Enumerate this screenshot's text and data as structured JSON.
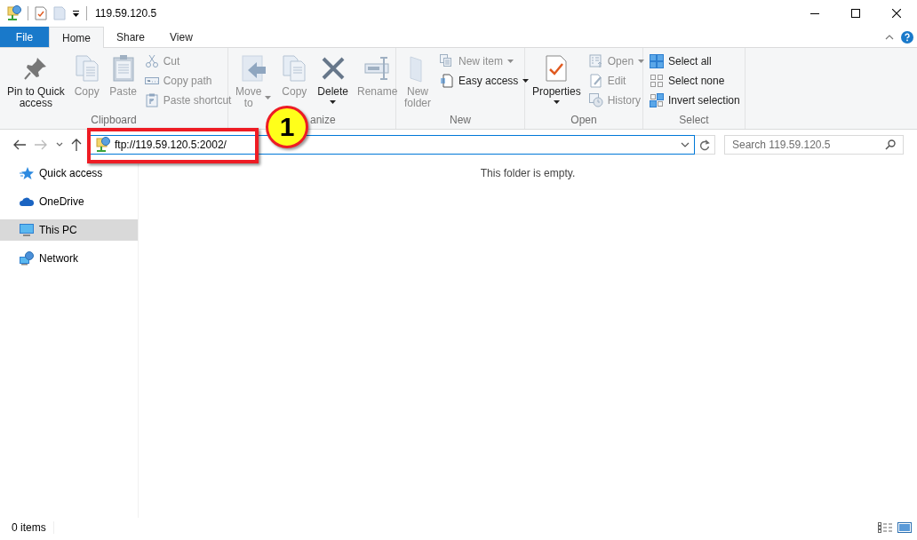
{
  "window": {
    "title": "119.59.120.5"
  },
  "tabs": [
    {
      "label": "File",
      "kind": "file",
      "selected": false
    },
    {
      "label": "Home",
      "kind": "tab",
      "selected": true
    },
    {
      "label": "Share",
      "kind": "tab",
      "selected": false
    },
    {
      "label": "View",
      "kind": "tab",
      "selected": false
    }
  ],
  "ribbon": {
    "groups": [
      {
        "label": "Clipboard",
        "items": [
          {
            "kind": "large",
            "label": "Pin to Quick\naccess",
            "disabled": false,
            "dropdown": false
          },
          {
            "kind": "large",
            "label": "Copy",
            "disabled": true,
            "dropdown": false
          },
          {
            "kind": "large",
            "label": "Paste",
            "disabled": true,
            "dropdown": false
          },
          {
            "kind": "small",
            "label": "Cut",
            "disabled": true,
            "dropdown": false
          },
          {
            "kind": "small",
            "label": "Copy path",
            "disabled": true,
            "dropdown": false
          },
          {
            "kind": "small",
            "label": "Paste shortcut",
            "disabled": true,
            "dropdown": false
          }
        ]
      },
      {
        "label": "anize",
        "items": [
          {
            "kind": "large",
            "label": "Move\nto",
            "disabled": true,
            "dropdown": true
          },
          {
            "kind": "large",
            "label": "Copy",
            "disabled": true,
            "dropdown": false
          },
          {
            "kind": "split",
            "label": "Delete",
            "disabled": false,
            "dropdown": true
          },
          {
            "kind": "large",
            "label": "Rename",
            "disabled": true,
            "dropdown": false
          }
        ]
      },
      {
        "label": "New",
        "items": [
          {
            "kind": "large",
            "label": "New\nfolder",
            "disabled": true,
            "dropdown": false
          },
          {
            "kind": "small",
            "label": "New item",
            "disabled": true,
            "dropdown": true
          },
          {
            "kind": "small",
            "label": "Easy access",
            "disabled": false,
            "dropdown": true
          }
        ]
      },
      {
        "label": "Open",
        "items": [
          {
            "kind": "split",
            "label": "Properties",
            "disabled": false,
            "dropdown": true
          },
          {
            "kind": "small",
            "label": "Open",
            "disabled": true,
            "dropdown": true
          },
          {
            "kind": "small",
            "label": "Edit",
            "disabled": true,
            "dropdown": false
          },
          {
            "kind": "small",
            "label": "History",
            "disabled": true,
            "dropdown": false
          }
        ]
      },
      {
        "label": "Select",
        "items": [
          {
            "kind": "small",
            "label": "Select all",
            "disabled": false,
            "dropdown": false
          },
          {
            "kind": "small",
            "label": "Select none",
            "disabled": false,
            "dropdown": false
          },
          {
            "kind": "small",
            "label": "Invert selection",
            "disabled": false,
            "dropdown": false
          }
        ]
      }
    ]
  },
  "address": {
    "value": "ftp://119.59.120.5:2002/"
  },
  "search": {
    "placeholder": "Search 119.59.120.5"
  },
  "annotation": {
    "number": "1"
  },
  "sidebar": {
    "items": [
      {
        "label": "Quick access",
        "selected": false
      },
      {
        "label": "OneDrive",
        "selected": false
      },
      {
        "label": "This PC",
        "selected": true
      },
      {
        "label": "Network",
        "selected": false
      }
    ]
  },
  "content": {
    "message": "This folder is empty."
  },
  "status_bar": {
    "item_count": "0 items"
  }
}
